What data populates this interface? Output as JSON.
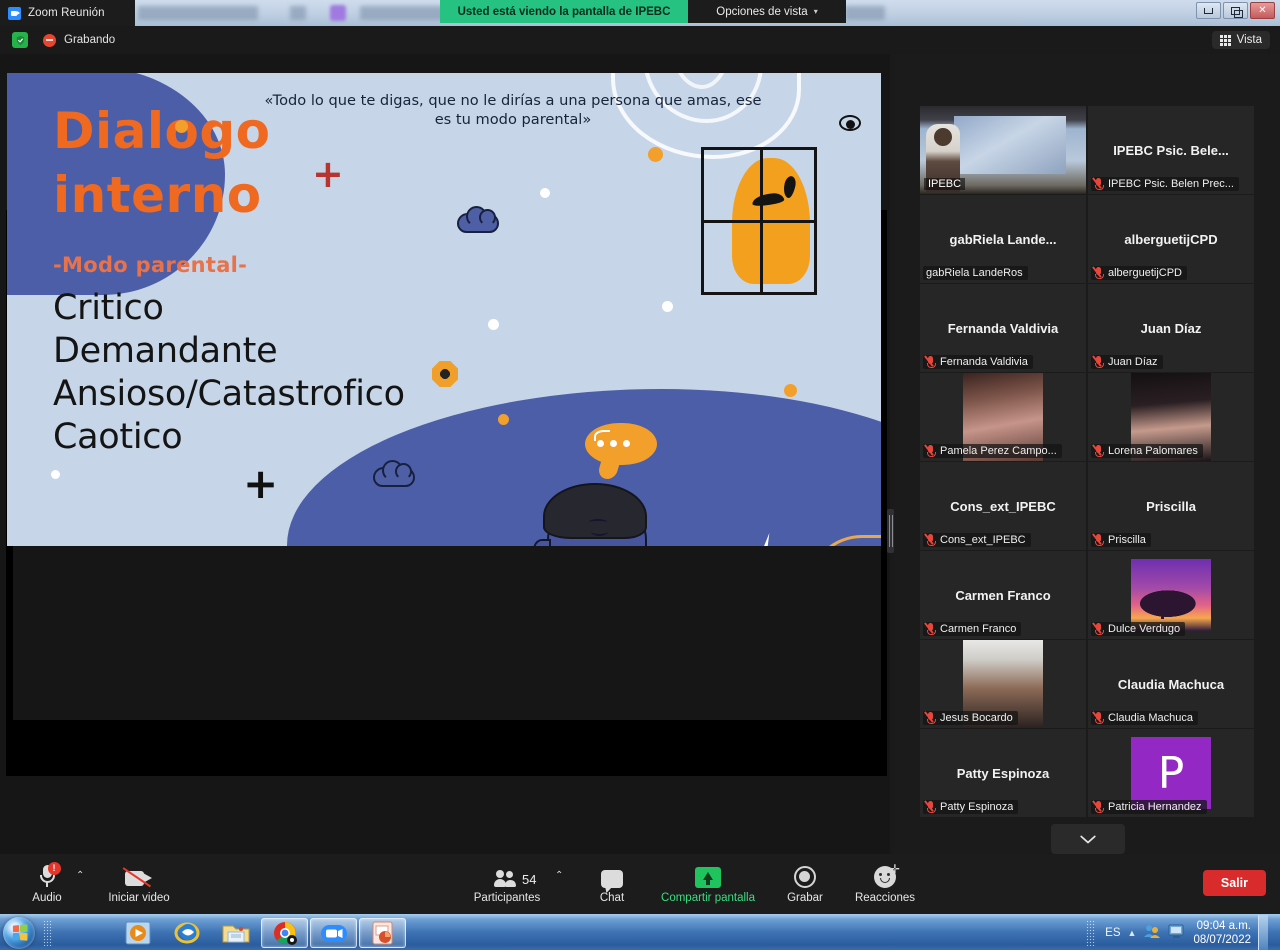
{
  "titlebar": {
    "app_title": "Zoom Reunión",
    "share_banner": "Usted está viendo la pantalla de IPEBC",
    "view_options": "Opciones de vista",
    "caret": "⌄",
    "minimize": "minimize",
    "maximize": "maximize",
    "close": "✕"
  },
  "statusbar": {
    "recording_label": "Grabando",
    "view_button": "Vista"
  },
  "slide": {
    "quote": "«Todo lo que te digas, que no le dirías a una persona que amas, ese es tu modo parental»",
    "title_line1": "Dialogo",
    "title_line2": "interno",
    "subtitle": "-Modo parental-",
    "list": [
      "Critico",
      "Demandante",
      "Ansioso/Catastrofico",
      "Caotico"
    ],
    "plus1": "+",
    "plus2": "+",
    "colors": {
      "background": "#c6d6e8",
      "blob": "#4d5ea8",
      "title": "#ef6a20",
      "subtitle": "#e8724a",
      "accent_orange": "#f2a02b"
    }
  },
  "participants": {
    "tiles": [
      {
        "big": "",
        "name": "IPEBC",
        "muted": false,
        "active": true,
        "media": "ipebc-video",
        "overlay": "IPEBC"
      },
      {
        "big": "IPEBC Psic. Bele...",
        "name": "IPEBC Psic. Belen Prec...",
        "muted": true,
        "active": false,
        "media": "none"
      },
      {
        "big": "gabRiela  Lande...",
        "name": "gabRiela LandeRos",
        "muted": false,
        "active": false,
        "media": "none"
      },
      {
        "big": "alberguetijCPD",
        "name": "alberguetijCPD",
        "muted": true,
        "active": false,
        "media": "none"
      },
      {
        "big": "Fernanda Valdivia",
        "name": "Fernanda Valdivia",
        "muted": true,
        "active": false,
        "media": "none"
      },
      {
        "big": "Juan Díaz",
        "name": "Juan Díaz",
        "muted": true,
        "active": false,
        "media": "none"
      },
      {
        "big": "",
        "name": "Pamela Perez Campo...",
        "muted": true,
        "active": false,
        "media": "photo-pamela"
      },
      {
        "big": "",
        "name": "Lorena Palomares",
        "muted": true,
        "active": false,
        "media": "photo-lorena"
      },
      {
        "big": "Cons_ext_IPEBC",
        "name": "Cons_ext_IPEBC",
        "muted": true,
        "active": false,
        "media": "none"
      },
      {
        "big": "Priscilla",
        "name": "Priscilla",
        "muted": true,
        "active": false,
        "media": "none"
      },
      {
        "big": "Carmen Franco",
        "name": "Carmen Franco",
        "muted": true,
        "active": false,
        "media": "none"
      },
      {
        "big": "",
        "name": "Dulce Verdugo",
        "muted": true,
        "active": false,
        "media": "photo-dulce"
      },
      {
        "big": "",
        "name": "Jesus Bocardo",
        "muted": true,
        "active": false,
        "media": "photo-jesus"
      },
      {
        "big": "Claudia Machuca",
        "name": "Claudia Machuca",
        "muted": true,
        "active": false,
        "media": "none"
      },
      {
        "big": "Patty Espinoza",
        "name": "Patty Espinoza",
        "muted": true,
        "active": false,
        "media": "none"
      },
      {
        "big": "",
        "name": "Patricia Hernandez",
        "muted": true,
        "active": false,
        "media": "avatar-letter",
        "letter": "P"
      }
    ]
  },
  "toolbar": {
    "audio": "Audio",
    "audio_badge": "!",
    "start_video": "Iniciar video",
    "participants": "Participantes",
    "participants_count": "54",
    "chat": "Chat",
    "share_screen": "Compartir pantalla",
    "record": "Grabar",
    "reactions": "Reacciones",
    "leave": "Salir",
    "caret": "⌃"
  },
  "taskbar": {
    "language": "ES",
    "time": "09:04 a.m.",
    "date": "08/07/2022",
    "items": [
      "start-orb",
      "media-player",
      "internet-explorer",
      "file-explorer",
      "google-chrome",
      "zoom",
      "powerpoint"
    ]
  }
}
